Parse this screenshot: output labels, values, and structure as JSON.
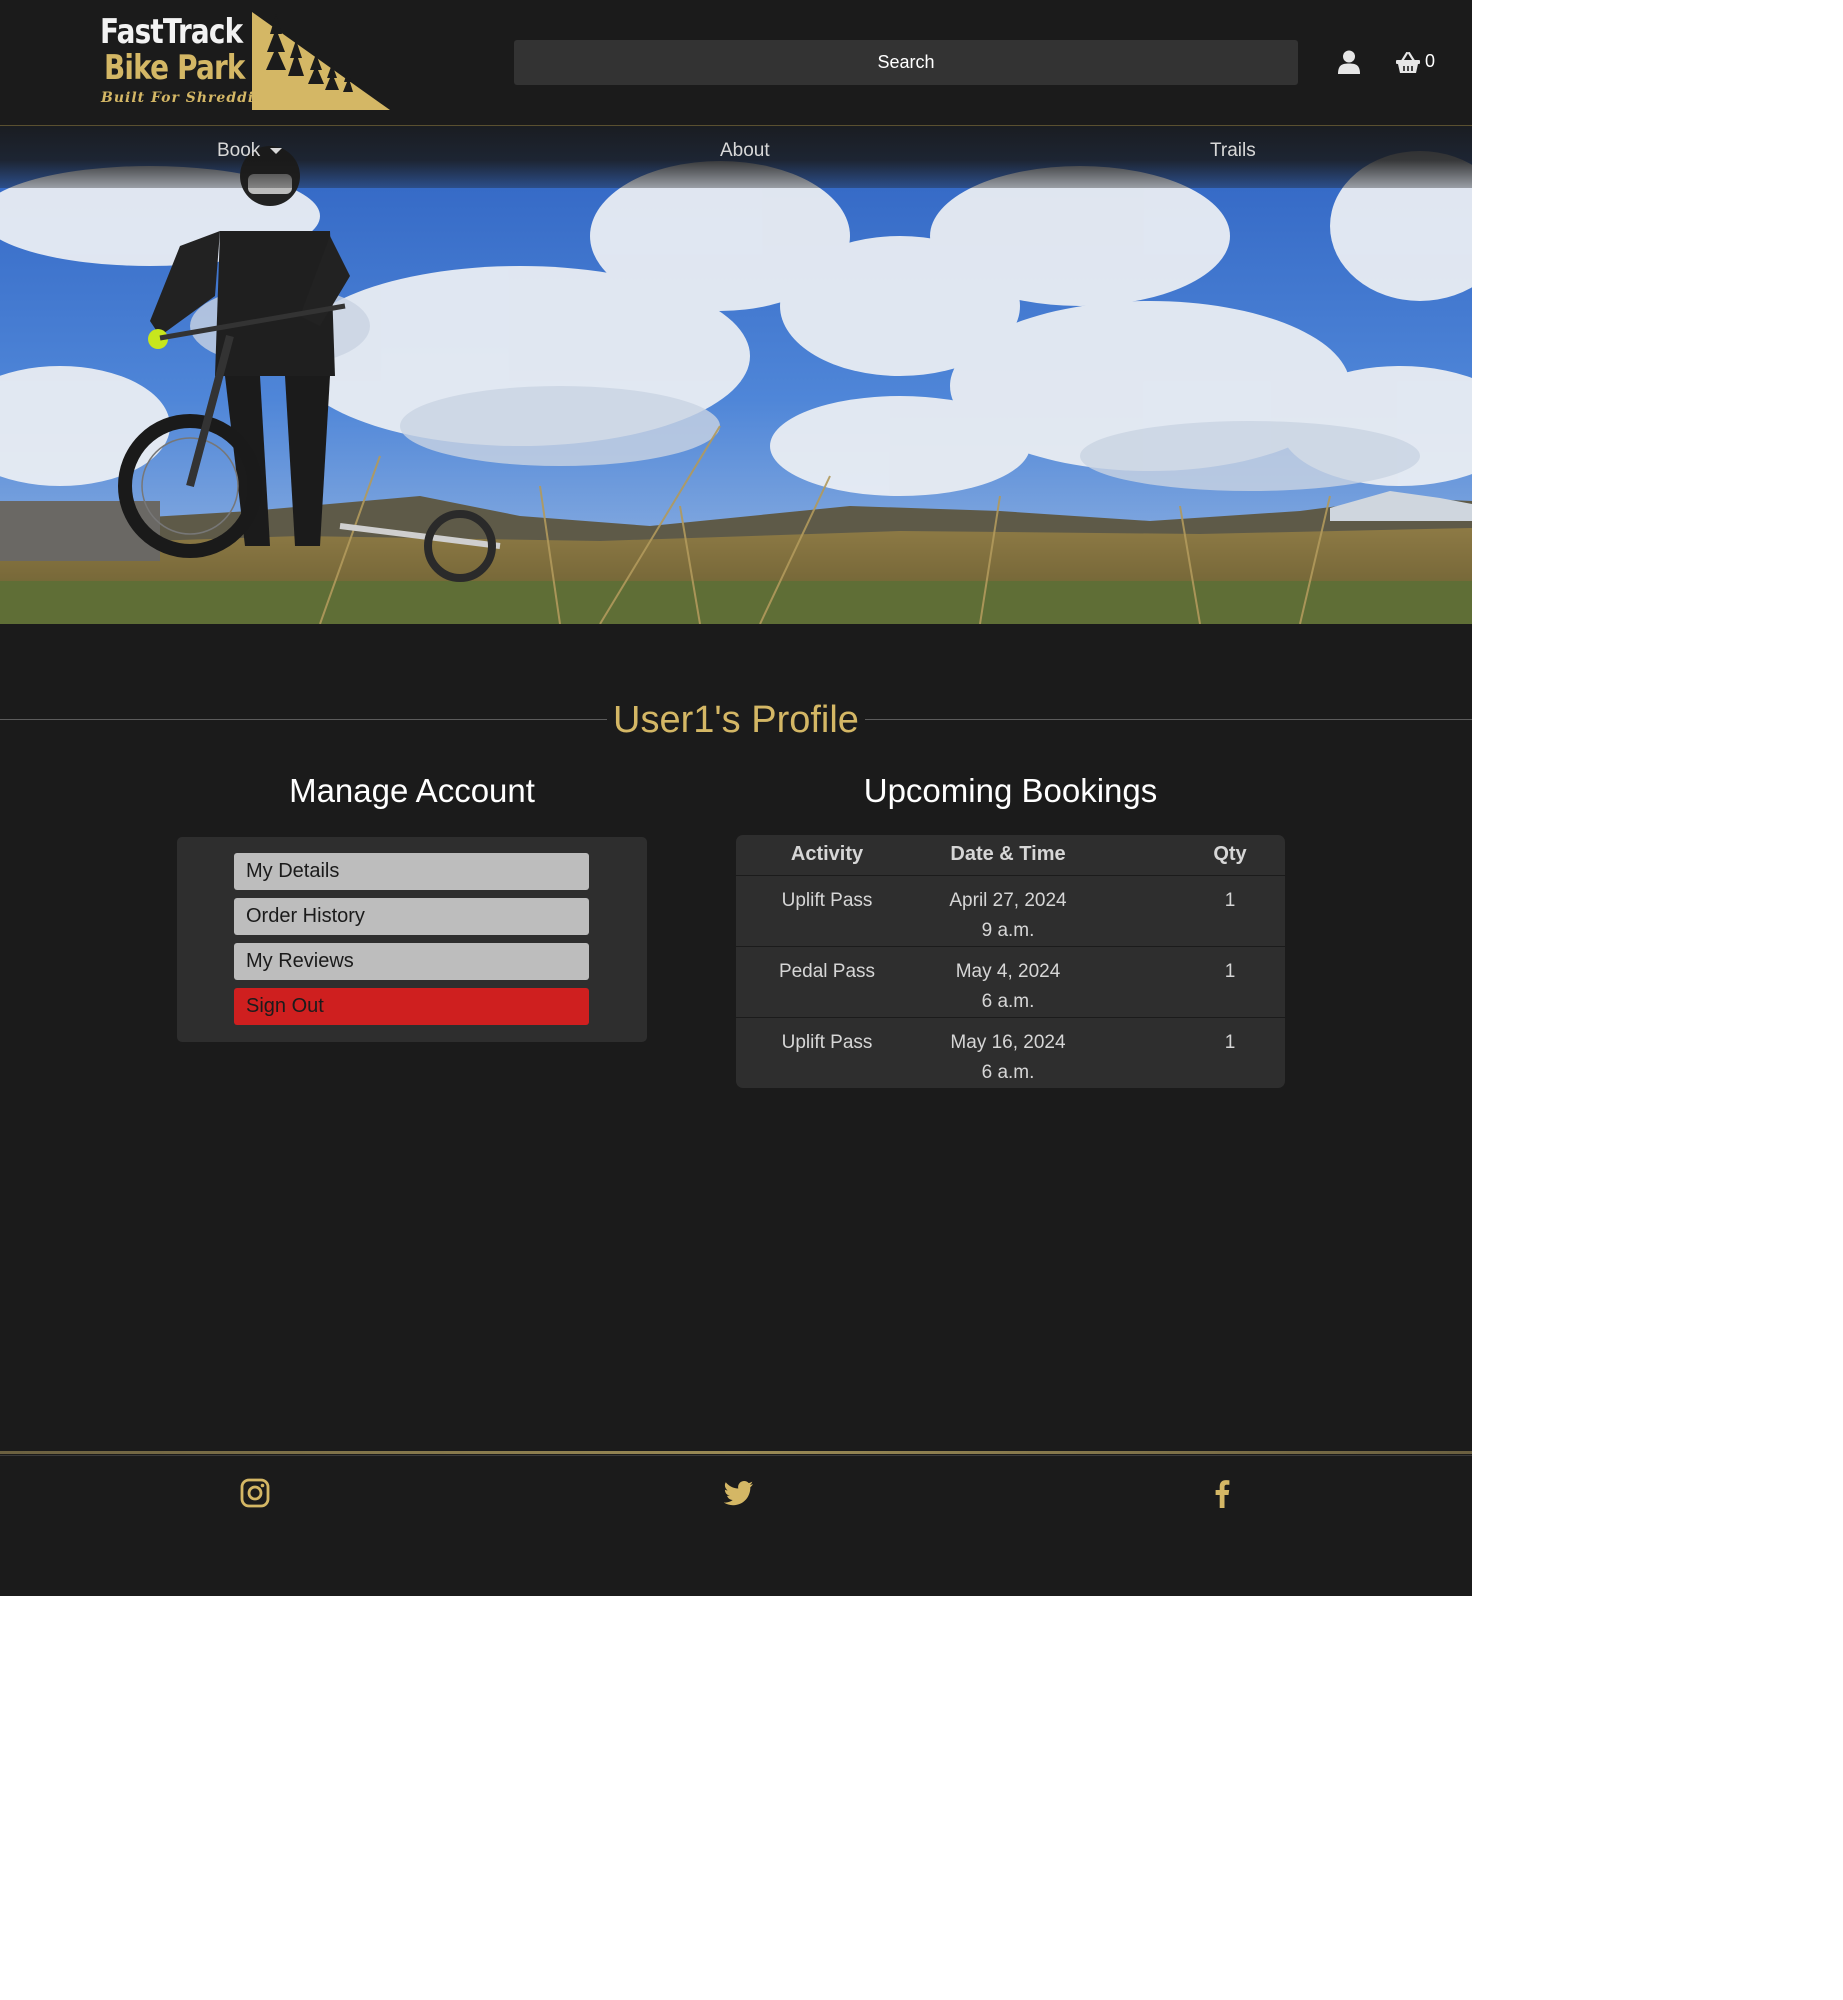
{
  "brand": {
    "line1": "FastTrack",
    "line2": "Bike Park",
    "tagline": "Built For Shredding",
    "accent_color": "#d4b765"
  },
  "header": {
    "search_label": "Search",
    "user_icon": "user-icon",
    "cart_icon": "basket-icon",
    "cart_count": "0"
  },
  "nav": {
    "book": "Book",
    "about": "About",
    "trails": "Trails"
  },
  "profile": {
    "title": "User1's Profile"
  },
  "manage": {
    "title": "Manage Account",
    "buttons": {
      "details": "My Details",
      "orders": "Order History",
      "reviews": "My Reviews",
      "signout": "Sign Out"
    },
    "signout_color": "#cf1f1f"
  },
  "bookings": {
    "title": "Upcoming Bookings",
    "columns": [
      "Activity",
      "Date & Time",
      "Qty"
    ],
    "rows": [
      {
        "activity": "Uplift Pass",
        "date": "April 27, 2024",
        "time": "9 a.m.",
        "qty": "1"
      },
      {
        "activity": "Pedal Pass",
        "date": "May 4, 2024",
        "time": "6 a.m.",
        "qty": "1"
      },
      {
        "activity": "Uplift Pass",
        "date": "May 16, 2024",
        "time": "6 a.m.",
        "qty": "1"
      }
    ]
  },
  "footer": {
    "icons": [
      "instagram-icon",
      "twitter-icon",
      "facebook-icon"
    ]
  }
}
